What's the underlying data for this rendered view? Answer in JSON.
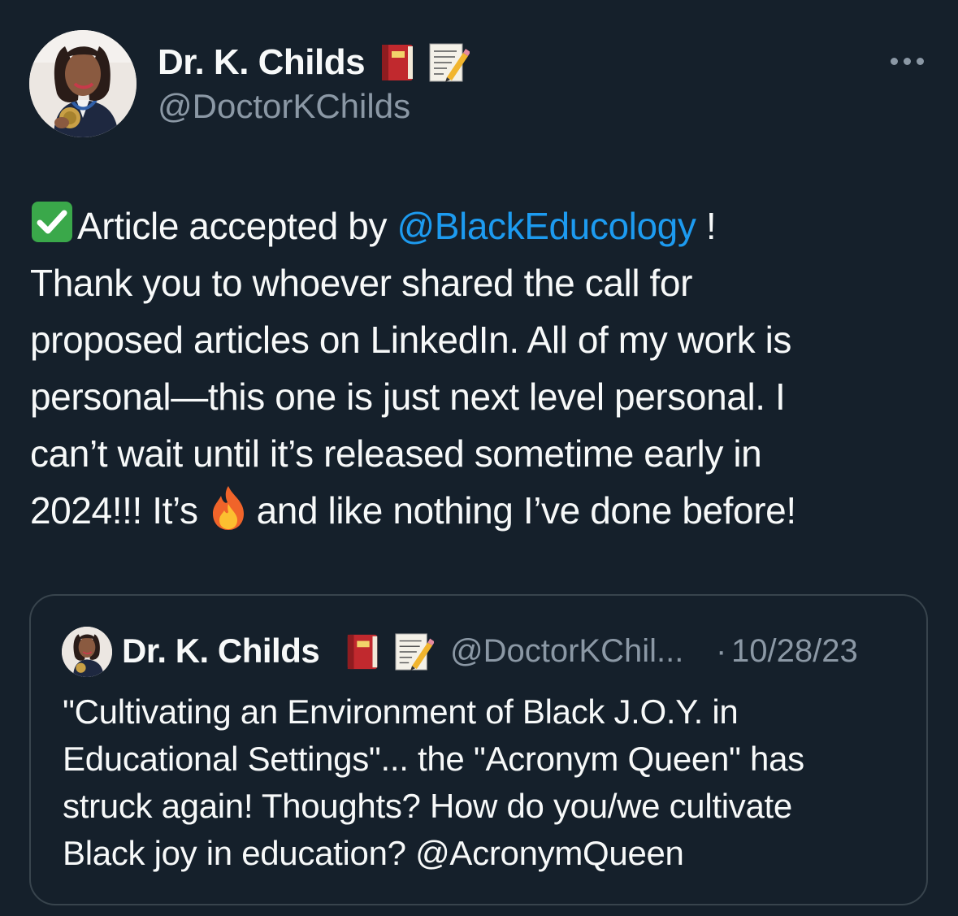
{
  "author": {
    "name": "Dr. K. Childs",
    "handle": "@DoctorKChilds",
    "name_emojis": [
      "closed-book-icon",
      "memo-icon"
    ]
  },
  "more_menu": {
    "icon": "more-horizontal-icon"
  },
  "tweet": {
    "line1_prefix_icon": "check-mark-button-icon",
    "line1_text": "Article accepted by ",
    "line1_mention": "@BlackEducology",
    "line1_suffix": " !",
    "line2": "Thank you to whoever shared the call for",
    "line3": "proposed articles on LinkedIn. All of my work is",
    "line4": "personal—this one is just next level personal. I",
    "line5": "can’t wait until it’s released sometime early in",
    "line6_before": "2024!!! It’s",
    "line6_icon": "fire-icon",
    "line6_after": "and like nothing I’ve done before!"
  },
  "quote": {
    "name": "Dr. K. Childs",
    "handle": "@DoctorKChil...",
    "separator": "·",
    "date": "10/28/23",
    "line1": "\"Cultivating an Environment of Black J.O.Y. in",
    "line2": "Educational Settings\"... the \"Acronym Queen\" has",
    "line3": "struck again! Thoughts? How do you/we cultivate",
    "line4_text": "Black joy in education? ",
    "line4_mention": "@AcronymQueen"
  },
  "colors": {
    "background": "#15202b",
    "text": "#f7f9f9",
    "secondary_text": "#8b98a5",
    "link": "#1d9bf0",
    "border": "#38444d"
  }
}
